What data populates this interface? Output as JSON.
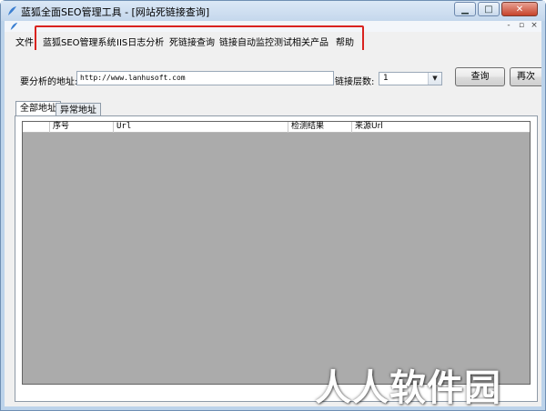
{
  "window": {
    "title": "蓝狐全面SEO管理工具 - [网站死链接查询]",
    "controls": {
      "minimize": "▁",
      "maximize": "□",
      "close": "✕"
    }
  },
  "mdi": {
    "controls": {
      "minimize": "-",
      "restore": "▫",
      "close": "×"
    }
  },
  "menu": {
    "items": [
      "文件",
      "蓝狐SEO管理系统",
      "IIS日志分析",
      "死链接查询",
      "链接自动监控测试",
      "相关产品",
      "帮助"
    ],
    "highlight_color": "#d9231f"
  },
  "form": {
    "url_label": "要分析的地址:",
    "url_value": "http://www.lanhusoft.com",
    "depth_label": "链接层数:",
    "depth_value": "1",
    "query_button": "查询",
    "requery_button": "再次"
  },
  "tabs": [
    "全部地址",
    "异常地址"
  ],
  "table": {
    "columns": [
      "序号",
      "Url",
      "检测结果",
      "来源Url"
    ]
  },
  "watermark": "人人软件园",
  "colors": {
    "grid_background": "#ababab",
    "window_frame": "#bcd3ea"
  }
}
